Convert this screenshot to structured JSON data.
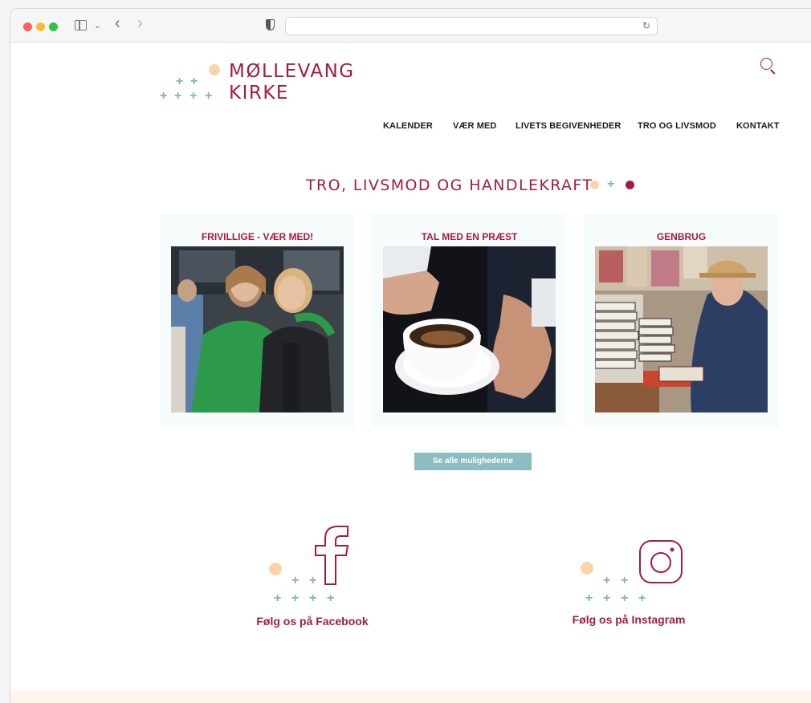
{
  "site": {
    "logo_line1": "MØLLEVANG",
    "logo_line2": "KIRKE"
  },
  "nav": {
    "items": [
      {
        "label": "KALENDER"
      },
      {
        "label": "VÆR MED"
      },
      {
        "label": "LIVETS BEGIVENHEDER"
      },
      {
        "label": "TRO OG LIVSMOD"
      },
      {
        "label": "KONTAKT"
      }
    ]
  },
  "section": {
    "title": "TRO, LIVSMOD OG HANDLEKRAFT"
  },
  "cards": [
    {
      "title": "FRIVILLIGE - VÆR MED!"
    },
    {
      "title": "TAL MED EN PRÆST"
    },
    {
      "title": "GENBRUG"
    }
  ],
  "cta": {
    "label": "Se alle mulighederne"
  },
  "social": {
    "facebook_label": "Følg os på Facebook",
    "instagram_label": "Følg os på Instagram"
  },
  "colors": {
    "brand_red": "#a31c44",
    "accent_teal": "#7fb4b8",
    "accent_peach": "#f7d5a8",
    "button_teal": "#8bbdc1"
  }
}
